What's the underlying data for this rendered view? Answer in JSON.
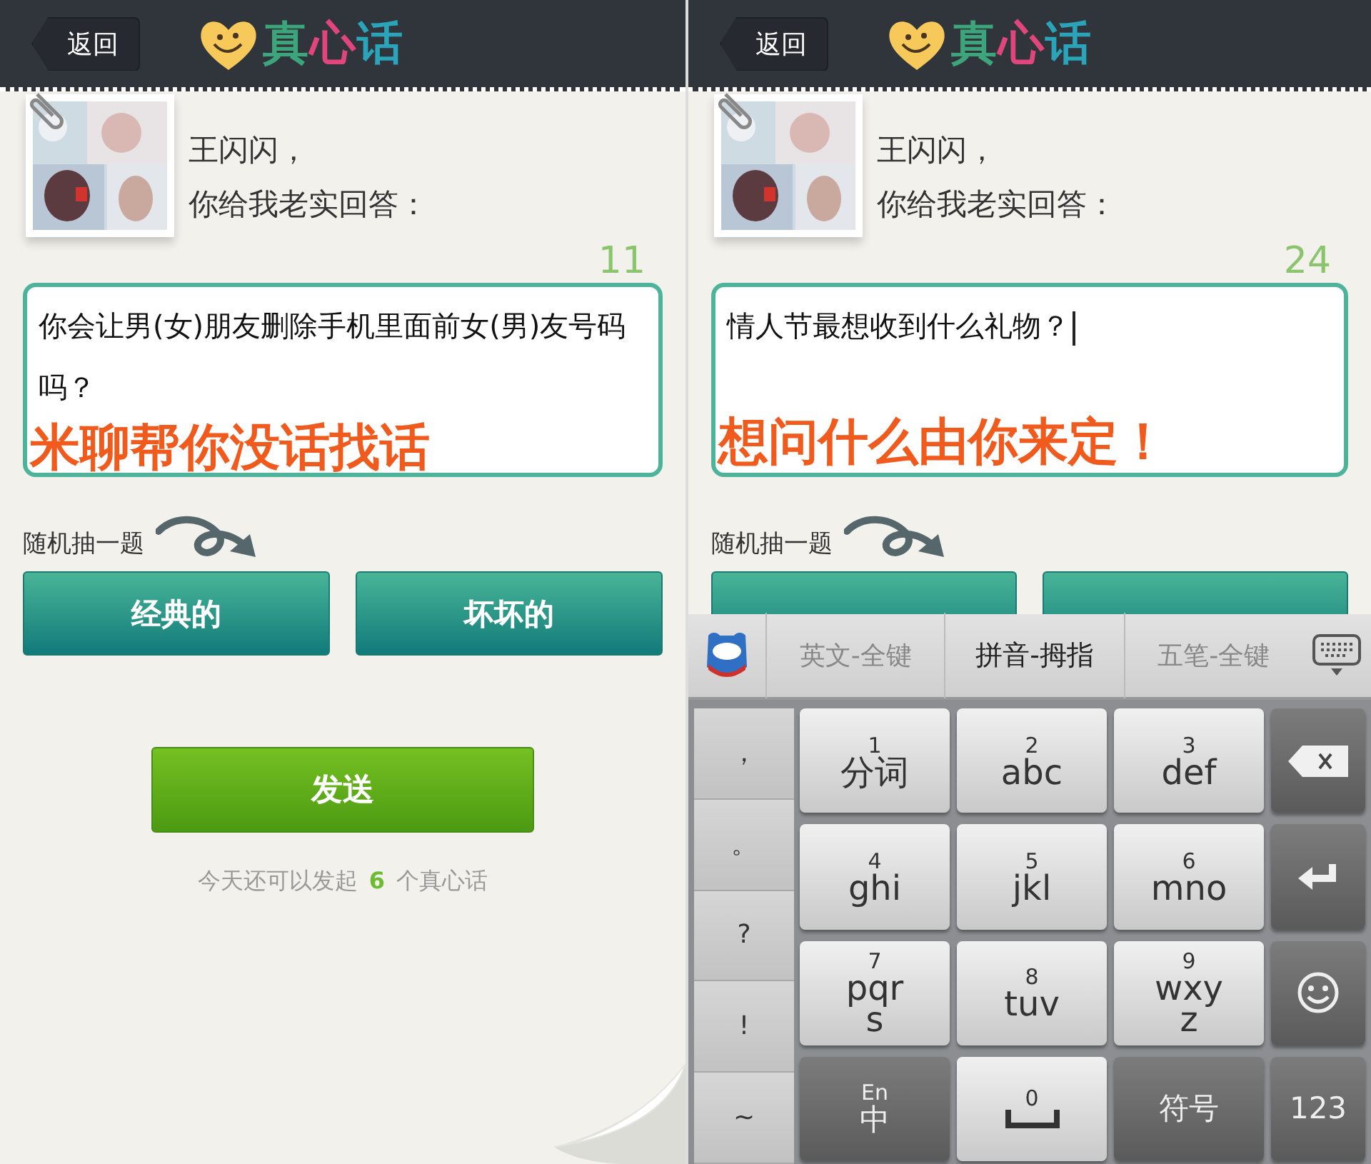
{
  "screens": [
    {
      "back": "返回",
      "logo": [
        {
          "text": "真",
          "color": "#3da57c"
        },
        {
          "text": "心",
          "color": "#e0467c"
        },
        {
          "text": "话",
          "color": "#2ba4b9"
        }
      ],
      "greeting": [
        "王闪闪，",
        "你给我老实回答："
      ],
      "count": "11",
      "question": "你会让男(女)朋友删除手机里面前女(男)友号码吗？",
      "caption": "米聊帮你没话找话",
      "random_label": "随机抽一题",
      "topic_buttons": [
        {
          "kind": "button",
          "label": "经典的"
        },
        {
          "kind": "button",
          "label": "坏坏的"
        }
      ],
      "send": "发送",
      "quota": {
        "before": "今天还可以发起",
        "count": "6",
        "after": "个真心话"
      },
      "page_curl": true
    },
    {
      "back": "返回",
      "logo": [
        {
          "text": "真",
          "color": "#3da57c"
        },
        {
          "text": "心",
          "color": "#e0467c"
        },
        {
          "text": "话",
          "color": "#2ba4b9"
        }
      ],
      "greeting": [
        "王闪闪，",
        "你给我老实回答："
      ],
      "count": "24",
      "question": "情人节最想收到什么礼物？",
      "cursor": true,
      "caption": "想问什么由你来定！",
      "random_label": "随机抽一题",
      "topic_buttons": [
        {
          "kind": "covered"
        },
        {
          "kind": "covered"
        }
      ],
      "keyboard": {
        "tabs": [
          {
            "label": "英文-全键",
            "selected": false
          },
          {
            "label": "拼音-拇指",
            "selected": true
          },
          {
            "label": "五笔-全键",
            "selected": false
          }
        ],
        "side_keys": [
          "，",
          "。",
          "?",
          "!",
          "~"
        ],
        "keys": [
          {
            "kind": "letter",
            "digit": "1",
            "label": "分词"
          },
          {
            "kind": "letter",
            "digit": "2",
            "label": "abc"
          },
          {
            "kind": "letter",
            "digit": "3",
            "label": "def"
          },
          {
            "kind": "delete"
          },
          {
            "kind": "letter",
            "digit": "4",
            "label": "ghi"
          },
          {
            "kind": "letter",
            "digit": "5",
            "label": "jkl"
          },
          {
            "kind": "letter",
            "digit": "6",
            "label": "mno"
          },
          {
            "kind": "enter"
          },
          {
            "kind": "letter",
            "digit": "7",
            "label": "pqr\ns"
          },
          {
            "kind": "letter",
            "digit": "8",
            "label": "tuv"
          },
          {
            "kind": "letter",
            "digit": "9",
            "label": "wxy\nz"
          },
          {
            "kind": "emoji"
          },
          {
            "kind": "dark",
            "digit": "En",
            "label": "中"
          },
          {
            "kind": "space",
            "digit": "0"
          },
          {
            "kind": "dark",
            "label": "符号"
          },
          {
            "kind": "dark",
            "label": "123"
          }
        ]
      }
    }
  ]
}
